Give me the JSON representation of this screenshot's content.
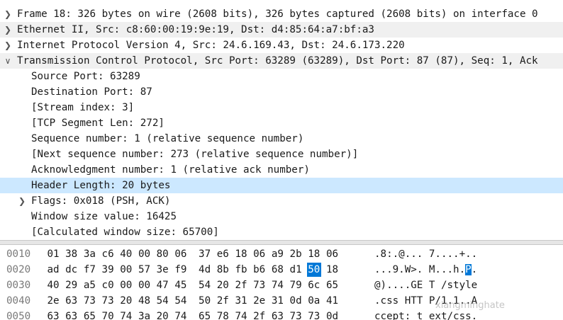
{
  "colors": {
    "selection": "#cce8ff",
    "hex_highlight": "#0078d7"
  },
  "tree": [
    {
      "text": "Frame 18: 326 bytes on wire (2608 bits), 326 bytes captured (2608 bits) on interface 0",
      "level": 0,
      "arrow": "chevron-right-icon"
    },
    {
      "text": "Ethernet II, Src: c8:60:00:19:9e:19, Dst: d4:85:64:a7:bf:a3",
      "level": 0,
      "arrow": "chevron-right-icon"
    },
    {
      "text": "Internet Protocol Version 4, Src: 24.6.169.43, Dst: 24.6.173.220",
      "level": 0,
      "arrow": "chevron-right-icon"
    },
    {
      "text": "Transmission Control Protocol, Src Port: 63289 (63289), Dst Port: 87 (87), Seq: 1, Ack",
      "level": 0,
      "arrow": "chevron-down-icon"
    },
    {
      "text": "Source Port: 63289",
      "level": 1
    },
    {
      "text": "Destination Port: 87",
      "level": 1
    },
    {
      "text": "[Stream index: 3]",
      "level": 1
    },
    {
      "text": "[TCP Segment Len: 272]",
      "level": 1
    },
    {
      "text": "Sequence number: 1    (relative sequence number)",
      "level": 1
    },
    {
      "text": "[Next sequence number: 273    (relative sequence number)]",
      "level": 1
    },
    {
      "text": "Acknowledgment number: 1    (relative ack number)",
      "level": 1
    },
    {
      "text": "Header Length: 20 bytes",
      "level": 1,
      "selected": true
    },
    {
      "text": "Flags: 0x018 (PSH, ACK)",
      "level": 1,
      "arrow": "chevron-right-icon"
    },
    {
      "text": "Window size value: 16425",
      "level": 1
    },
    {
      "text": "[Calculated window size: 65700]",
      "level": 1
    }
  ],
  "hex_rows": [
    {
      "offset": "0010",
      "bytes": [
        "01",
        "38",
        "3a",
        "c6",
        "40",
        "00",
        "80",
        "06",
        "37",
        "e6",
        "18",
        "06",
        "a9",
        "2b",
        "18",
        "06"
      ],
      "ascii": ".8:.@... 7....+.."
    },
    {
      "offset": "0020",
      "bytes": [
        "ad",
        "dc",
        "f7",
        "39",
        "00",
        "57",
        "3e",
        "f9",
        "4d",
        "8b",
        "fb",
        "b6",
        "68",
        "d1",
        "50",
        "18"
      ],
      "ascii": "...9.W>. M...h.P.",
      "highlight_index": 14
    },
    {
      "offset": "0030",
      "bytes": [
        "40",
        "29",
        "a5",
        "c0",
        "00",
        "00",
        "47",
        "45",
        "54",
        "20",
        "2f",
        "73",
        "74",
        "79",
        "6c",
        "65"
      ],
      "ascii": "@)....GE T /style"
    },
    {
      "offset": "0040",
      "bytes": [
        "2e",
        "63",
        "73",
        "73",
        "20",
        "48",
        "54",
        "54",
        "50",
        "2f",
        "31",
        "2e",
        "31",
        "0d",
        "0a",
        "41"
      ],
      "ascii": ".css HTT P/1.1..A"
    },
    {
      "offset": "0050",
      "bytes": [
        "63",
        "63",
        "65",
        "70",
        "74",
        "3a",
        "20",
        "74",
        "65",
        "78",
        "74",
        "2f",
        "63",
        "73",
        "73",
        "0d"
      ],
      "ascii": "ccept: t ext/css."
    }
  ],
  "watermark": "xiangminghate"
}
